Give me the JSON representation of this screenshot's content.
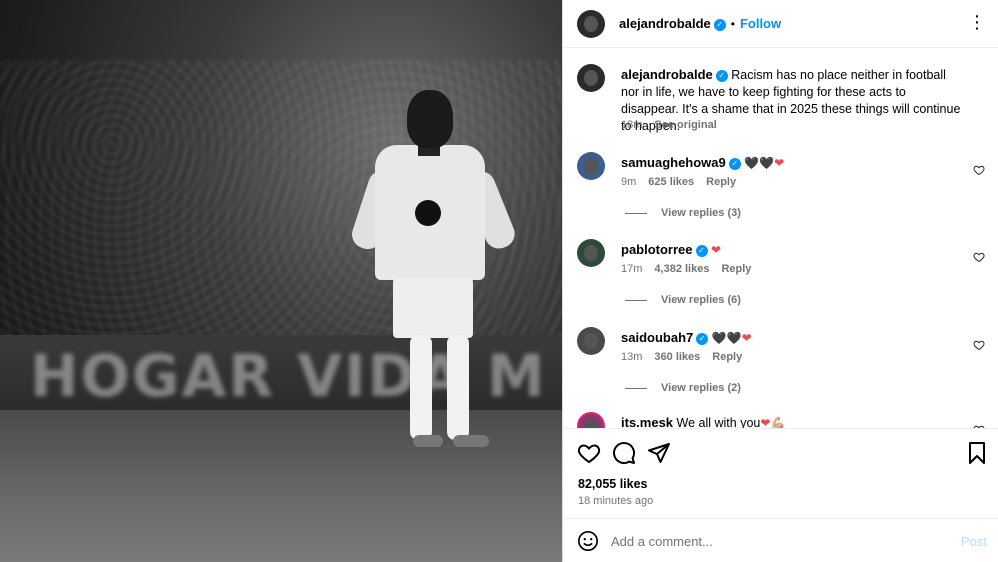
{
  "photo": {
    "board_text": "HOGAR  VIDA  M"
  },
  "header": {
    "username": "alejandrobalde",
    "follow_label": "Follow",
    "separator": "•",
    "more_icon": "⋮"
  },
  "verified_icon": "✓",
  "caption": {
    "username": "alejandrobalde",
    "text": "Racism has no place neither in football nor in life, we have to keep fighting for these acts to disappear. It's a shame that in 2025 these things will continue to happen.",
    "time": "18m",
    "see_original": "See original"
  },
  "comments": [
    {
      "username": "samuaghehowa9",
      "emoji": "🖤🖤",
      "heart": "❤",
      "time": "9m",
      "likes": "625 likes",
      "reply": "Reply",
      "view_replies": "View replies (3)"
    },
    {
      "username": "pablotorree",
      "emoji": "",
      "heart": "❤",
      "time": "17m",
      "likes": "4,382 likes",
      "reply": "Reply",
      "view_replies": "View replies (6)"
    },
    {
      "username": "saidoubah7",
      "emoji": "🖤🖤",
      "heart": "❤",
      "time": "13m",
      "likes": "360 likes",
      "reply": "Reply",
      "view_replies": "View replies (2)"
    },
    {
      "username": "its.mesk",
      "text": "We all with you",
      "heart": "❤",
      "extra": "💪🏼"
    }
  ],
  "footer": {
    "likes": "82,055 likes",
    "time_ago": "18 minutes ago",
    "comment_placeholder": "Add a comment...",
    "post_label": "Post"
  },
  "colors": {
    "accent": "#0095f6",
    "heart": "#ed4956",
    "muted": "#737373"
  }
}
